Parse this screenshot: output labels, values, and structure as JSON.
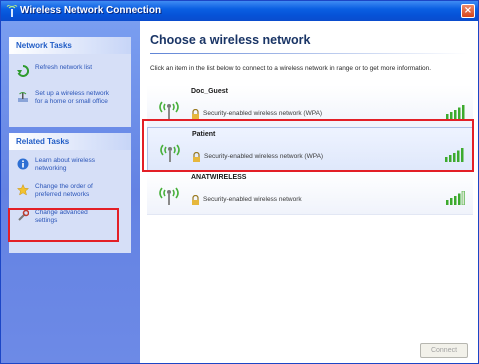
{
  "window": {
    "title": "Wireless Network Connection"
  },
  "sidebar": {
    "network_tasks": {
      "header": "Network Tasks",
      "items": [
        {
          "label": "Refresh network list",
          "icon": "refresh-icon"
        },
        {
          "label": "Set up a wireless network\nfor a home or small office",
          "icon": "setup-wireless-icon"
        }
      ]
    },
    "related_tasks": {
      "header": "Related Tasks",
      "items": [
        {
          "label": "Learn about wireless\nnetworking",
          "icon": "info-icon"
        },
        {
          "label": "Change the order of\npreferred networks",
          "icon": "star-icon"
        },
        {
          "label": "Change advanced\nsettings",
          "icon": "settings-icon"
        }
      ]
    }
  },
  "main": {
    "heading": "Choose a wireless network",
    "instructions": "Click an item in the list below to connect to a wireless network in range or to get more information.",
    "networks": [
      {
        "ssid": "Doc_Guest",
        "security": "Security-enabled wireless network (WPA)",
        "signal_bars": 5
      },
      {
        "ssid": "Patient",
        "security": "Security-enabled wireless network (WPA)",
        "signal_bars": 5
      },
      {
        "ssid": "ANATWIRELESS",
        "security": "Security-enabled wireless network",
        "signal_bars": 4
      }
    ],
    "connect_label": "Connect"
  },
  "colors": {
    "highlight": "#e31f26",
    "titlebar": "#0653d8",
    "link": "#2b55b8"
  }
}
